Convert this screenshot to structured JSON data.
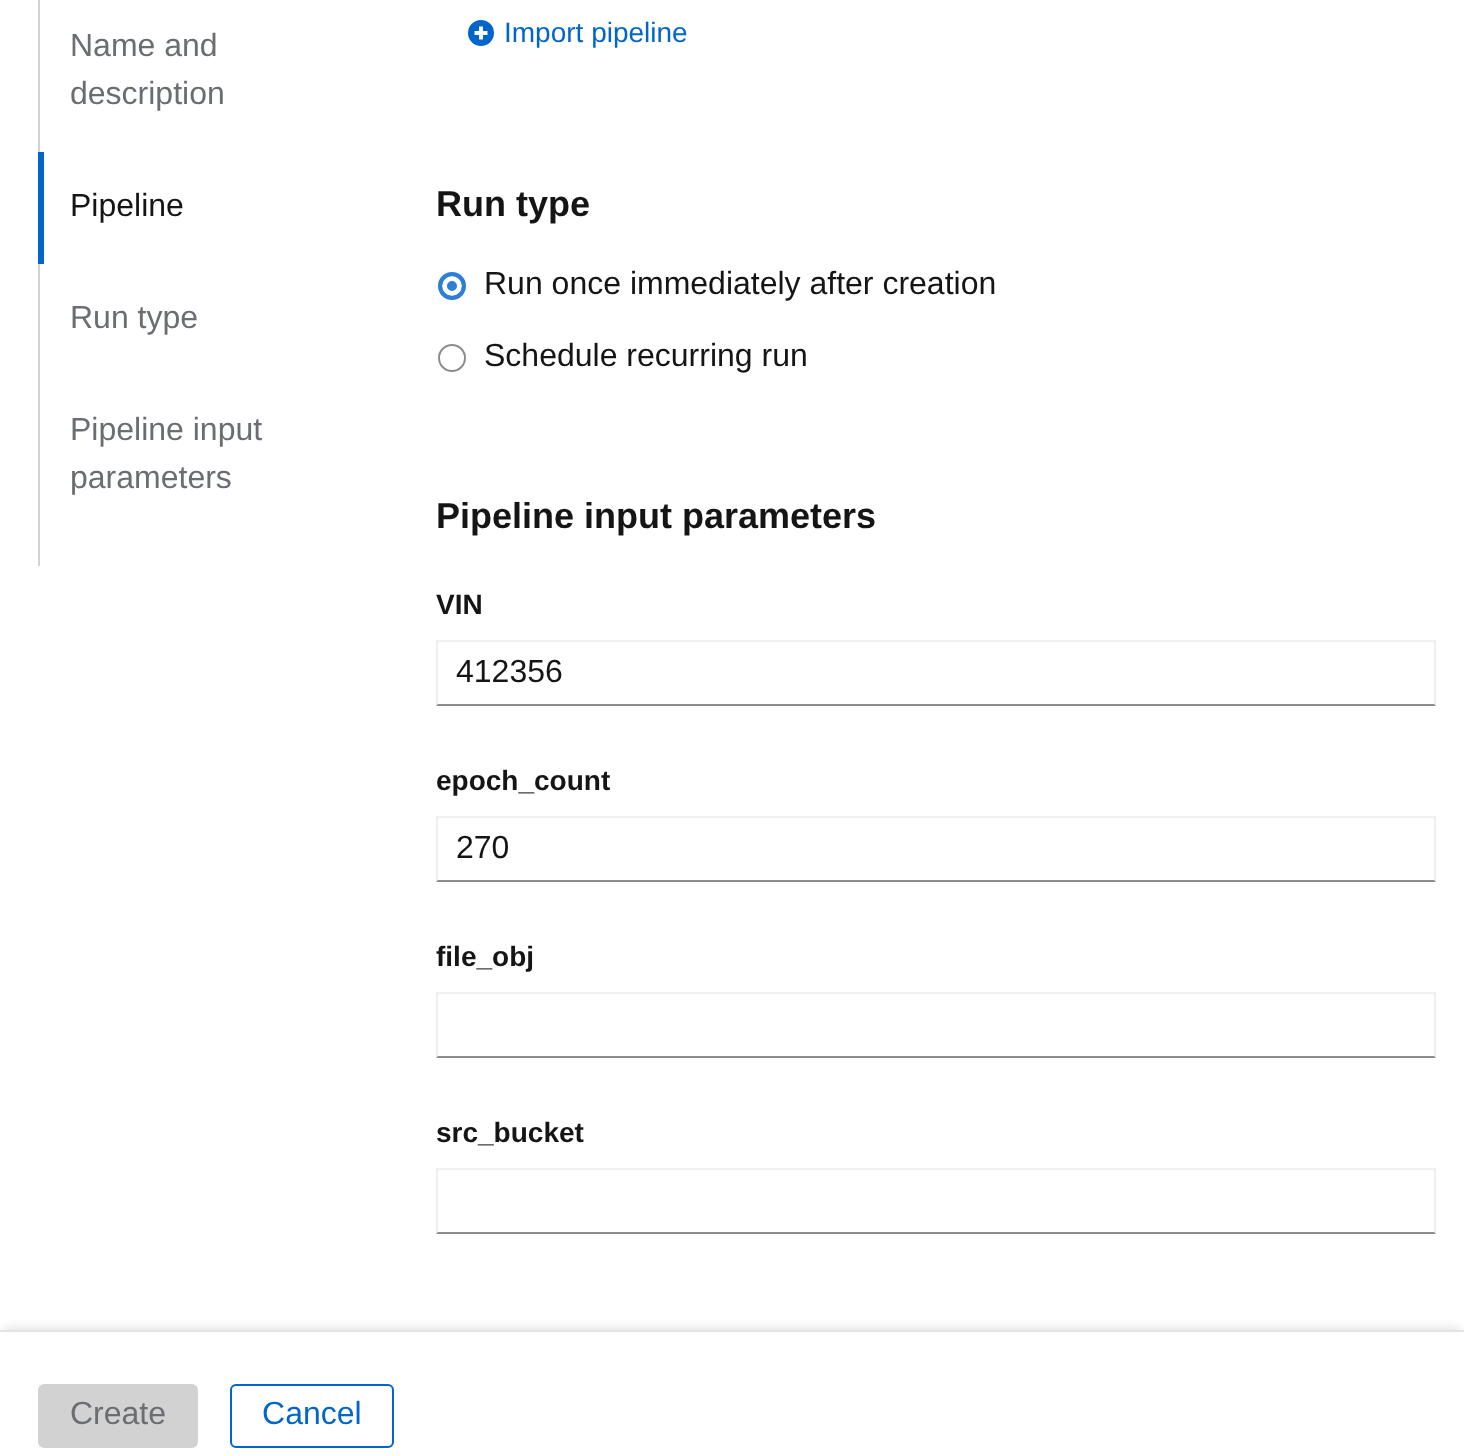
{
  "sidebar": {
    "items": [
      {
        "label": "Name and description",
        "selected": false
      },
      {
        "label": "Pipeline",
        "selected": true
      },
      {
        "label": "Run type",
        "selected": false
      },
      {
        "label": "Pipeline input parameters",
        "selected": false
      }
    ]
  },
  "import_link": {
    "label": "Import pipeline"
  },
  "run_type": {
    "title": "Run type",
    "options": [
      {
        "label": "Run once immediately after creation",
        "selected": true
      },
      {
        "label": "Schedule recurring run",
        "selected": false
      }
    ]
  },
  "parameters": {
    "title": "Pipeline input parameters",
    "fields": [
      {
        "label": "VIN",
        "value": "412356"
      },
      {
        "label": "epoch_count",
        "value": "270"
      },
      {
        "label": "file_obj"
      },
      {
        "label": "src_bucket"
      }
    ]
  },
  "footer": {
    "buttons": [
      {
        "label": "Create",
        "kind": "primary",
        "disabled": true
      },
      {
        "label": "Cancel",
        "kind": "secondary",
        "disabled": false
      }
    ]
  }
}
